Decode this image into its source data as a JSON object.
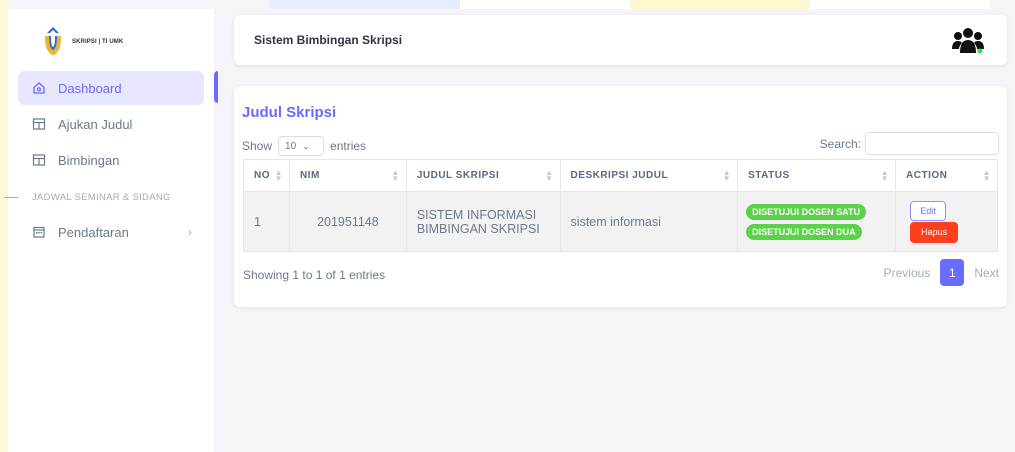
{
  "brand": {
    "text": "SKRIPSI | TI UMK"
  },
  "sidebar": {
    "items": [
      {
        "label": "Dashboard",
        "icon": "home-icon",
        "active": true
      },
      {
        "label": "Ajukan Judul",
        "icon": "table-icon",
        "active": false
      },
      {
        "label": "Bimbingan",
        "icon": "table-icon",
        "active": false
      }
    ],
    "section_header": "JADWAL SEMINAR & SIDANG",
    "items2": [
      {
        "label": "Pendaftaran",
        "icon": "calendar-icon",
        "has_submenu": true
      }
    ]
  },
  "navbar": {
    "title": "Sistem Bimbingan Skripsi",
    "user_icon": "users-icon"
  },
  "card": {
    "title": "Judul Skripsi",
    "show_label": "Show",
    "entries_value": "10",
    "entries_label": "entries",
    "search_label": "Search:",
    "search_value": ""
  },
  "table": {
    "headers": [
      "NO",
      "NIM",
      "JUDUL SKRIPSI",
      "DESKRIPSI JUDUL",
      "STATUS",
      "ACTION"
    ],
    "rows": [
      {
        "no": "1",
        "nim": "201951148",
        "judul": "SISTEM INFORMASI BIMBINGAN SKRIPSI",
        "deskripsi": "sistem informasi",
        "status": [
          "DISETUJUI DOSEN SATU",
          "DISETUJUI DOSEN DUA"
        ],
        "actions": {
          "edit": "Edit",
          "delete": "Hapus"
        }
      }
    ]
  },
  "footer": {
    "info": "Showing 1 to 1 of 1 entries",
    "prev": "Previous",
    "page": "1",
    "next": "Next"
  },
  "colors": {
    "accent": "#696cff",
    "success": "#5cd24b",
    "danger": "#ff3e1d"
  }
}
